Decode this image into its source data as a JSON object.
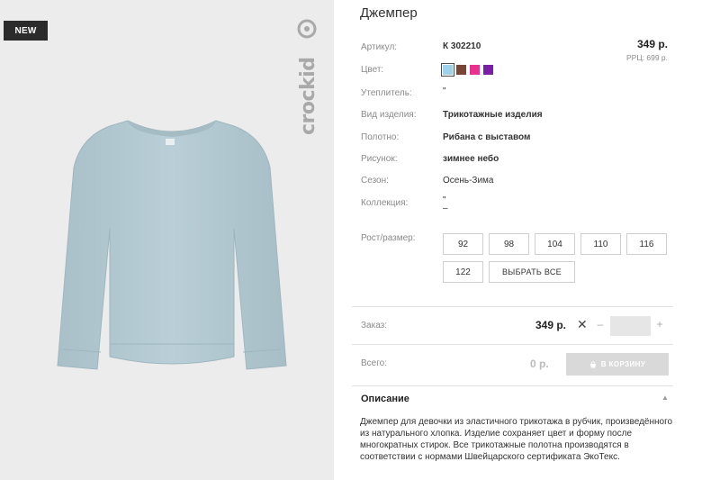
{
  "image": {
    "badge": "NEW",
    "brand": "crockid",
    "shirt_color": "#b7ccd4"
  },
  "product": {
    "title": "Джемпер",
    "price": "349 р.",
    "rrp": "РРЦ: 699 р."
  },
  "attributes": {
    "article": {
      "label": "Артикул:",
      "value": "К 302210"
    },
    "color": {
      "label": "Цвет:",
      "swatches": [
        "#9fd2ea",
        "#7a4436",
        "#e8308e",
        "#7b1ea8"
      ],
      "selected_index": 0
    },
    "insulation": {
      "label": "Утеплитель:",
      "value": "\""
    },
    "item_type": {
      "label": "Вид изделия:",
      "value": "Трикотажные изделия"
    },
    "fabric": {
      "label": "Полотно:",
      "value": "Рибана с выставом"
    },
    "pattern": {
      "label": "Рисунок:",
      "value": "зимнее небо"
    },
    "season": {
      "label": "Сезон:",
      "value": "Осень-Зима"
    },
    "collection": {
      "label": "Коллекция:",
      "value_line1": "\"",
      "value_line2": "–"
    }
  },
  "sizes": {
    "label": "Рост/размер:",
    "options": [
      "92",
      "98",
      "104",
      "110",
      "116",
      "122"
    ],
    "select_all": "ВЫБРАТЬ ВСЕ"
  },
  "order": {
    "label": "Заказ:",
    "price": "349 р.",
    "times": "✕",
    "minus": "–",
    "plus": "+",
    "quantity": ""
  },
  "total": {
    "label": "Всего:",
    "value": "0 р.",
    "cart_button": "В КОРЗИНУ"
  },
  "description": {
    "title": "Описание",
    "text": "Джемпер для девочки из эластичного трикотажа в рубчик, произведённого из натурального хлопка. Изделие сохраняет цвет и форму после многократных стирок. Все трикотажные полотна производятся в соответствии с нормами Швейцарского сертификата ЭкоТекс."
  }
}
